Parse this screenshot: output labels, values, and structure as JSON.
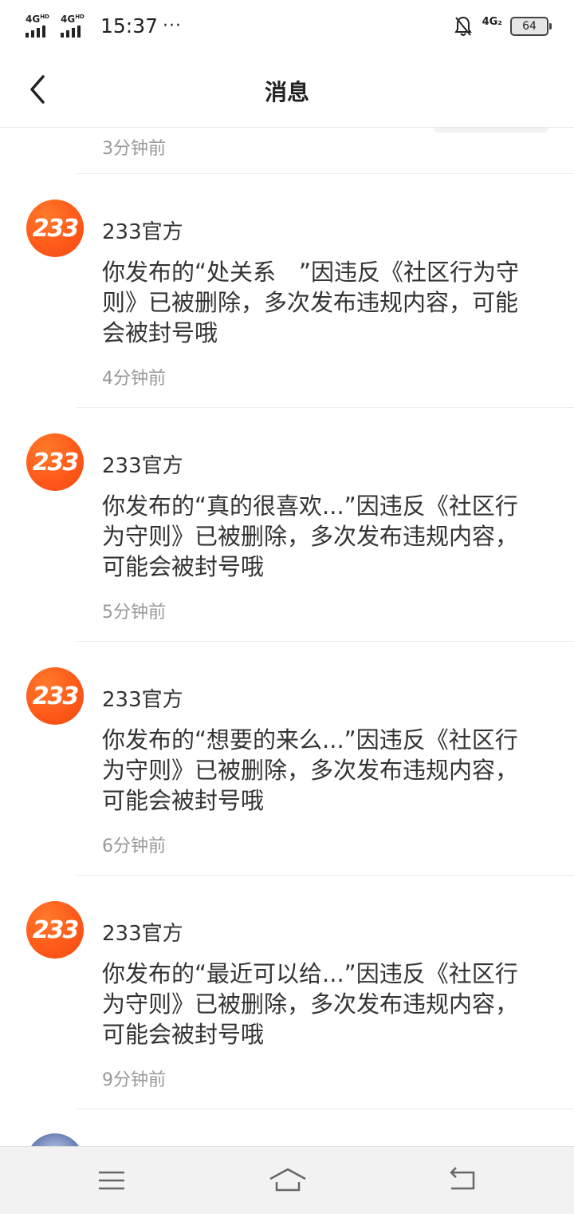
{
  "status_bar": {
    "network_1": "4G",
    "network_1_sub": "HD",
    "network_2": "4G",
    "network_2_sub": "HD",
    "time": "15:37",
    "more": "···",
    "network_right": "4G₂",
    "battery": "64"
  },
  "header": {
    "title": "消息"
  },
  "partial_top": {
    "time": "3分钟前"
  },
  "messages": [
    {
      "avatar_text": "233",
      "sender": "233官方",
      "content": "你发布的“处关系　”因违反《社区行为守则》已被删除，多次发布违规内容，可能会被封号哦",
      "time": "4分钟前"
    },
    {
      "avatar_text": "233",
      "sender": "233官方",
      "content": "你发布的“真的很喜欢...”因违反《社区行为守则》已被删除，多次发布违规内容，可能会被封号哦",
      "time": "5分钟前"
    },
    {
      "avatar_text": "233",
      "sender": "233官方",
      "content": "你发布的“想要的来么...”因违反《社区行为守则》已被删除，多次发布违规内容，可能会被封号哦",
      "time": "6分钟前"
    },
    {
      "avatar_text": "233",
      "sender": "233官方",
      "content": "你发布的“最近可以给...”因违反《社区行为守则》已被删除，多次发布违规内容，可能会被封号哦",
      "time": "9分钟前"
    }
  ],
  "colors": {
    "avatar_orange": "#ff5a1a",
    "text_primary": "#333333",
    "text_secondary": "#999999",
    "divider": "#ececec"
  },
  "icons": {
    "back": "chevron-left-icon",
    "menu": "menu-icon",
    "home": "home-icon",
    "return": "return-icon",
    "bell_off": "bell-off-icon"
  }
}
